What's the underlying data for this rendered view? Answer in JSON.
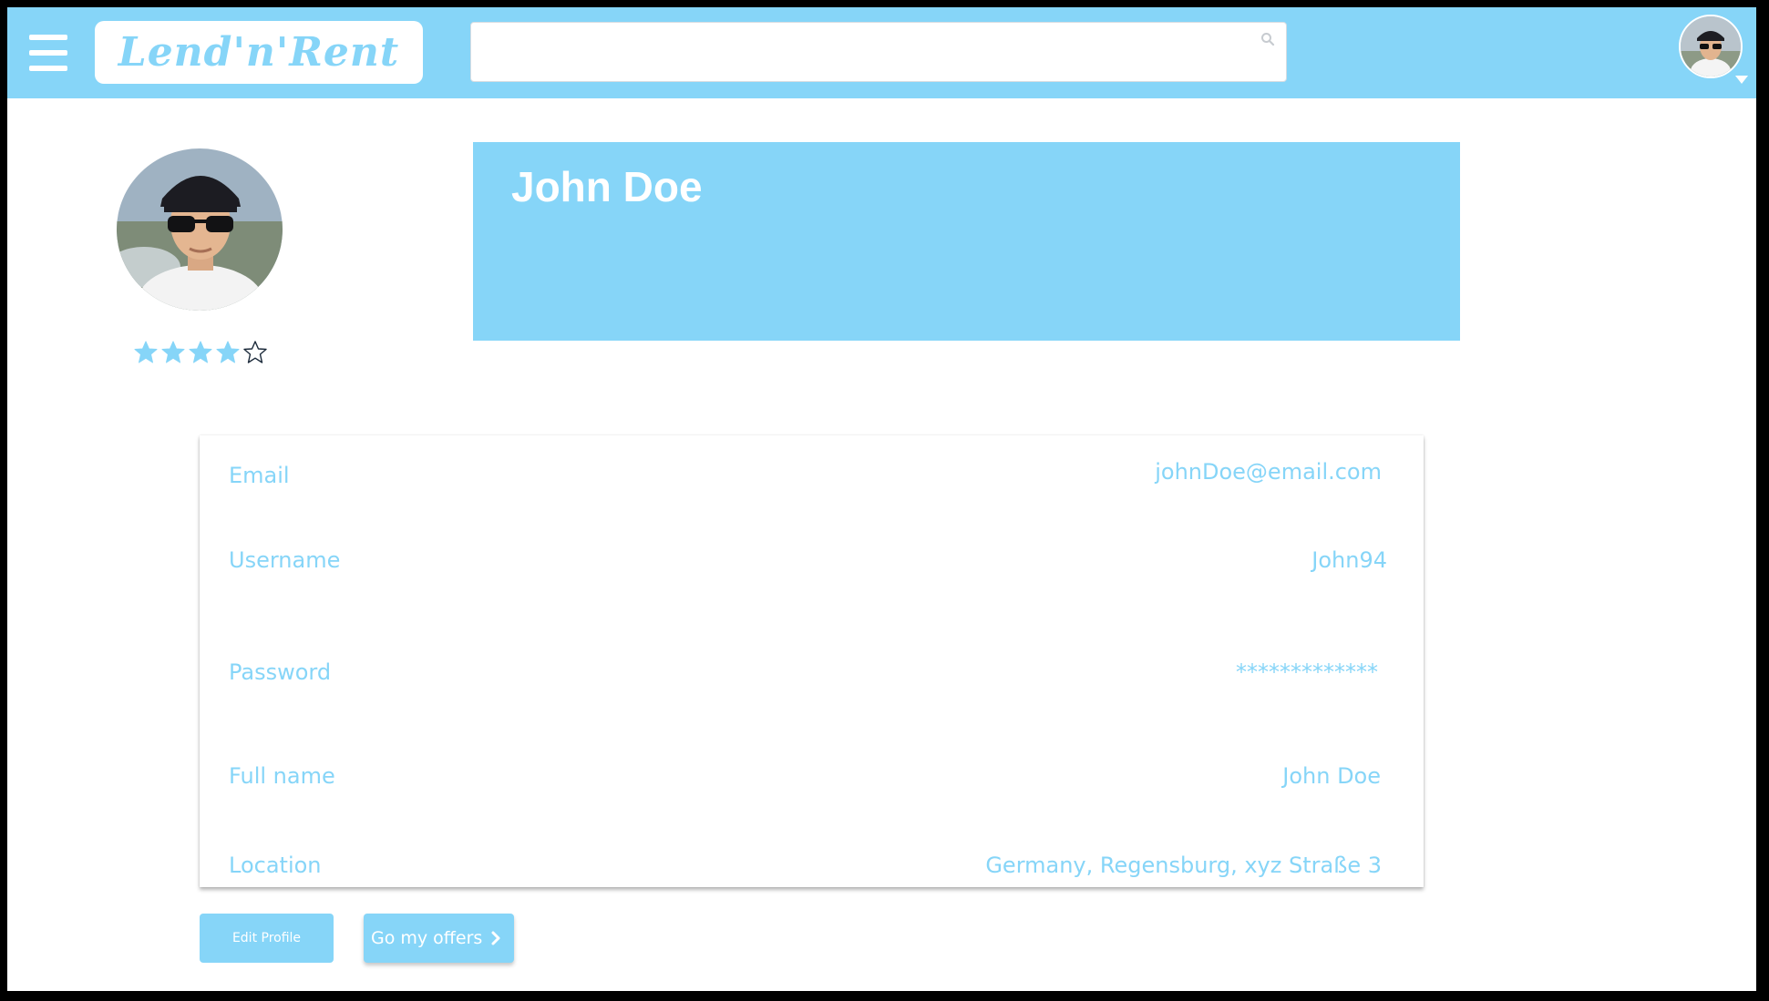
{
  "header": {
    "logo_text": "Lend'n'Rent",
    "search": {
      "placeholder": "",
      "value": ""
    },
    "icons": [
      "menu-icon",
      "search-icon",
      "user-avatar",
      "caret-down-icon"
    ]
  },
  "profile": {
    "name": "John Doe",
    "rating": 4,
    "rating_max": 5
  },
  "details": {
    "email": {
      "label": "Email",
      "value": "johnDoe@email.com"
    },
    "username": {
      "label": "Username",
      "value": "John94"
    },
    "password": {
      "label": "Password",
      "value": "*************"
    },
    "full_name": {
      "label": "Full name",
      "value": "John Doe"
    },
    "location": {
      "label": "Location",
      "value": "Germany, Regensburg, xyz Straße 3"
    }
  },
  "actions": {
    "edit_profile": "Edit Profile",
    "my_offers": "Go my offers"
  },
  "colors": {
    "accent": "#86d5f8",
    "frame": "#000000",
    "background": "#ffffff"
  }
}
